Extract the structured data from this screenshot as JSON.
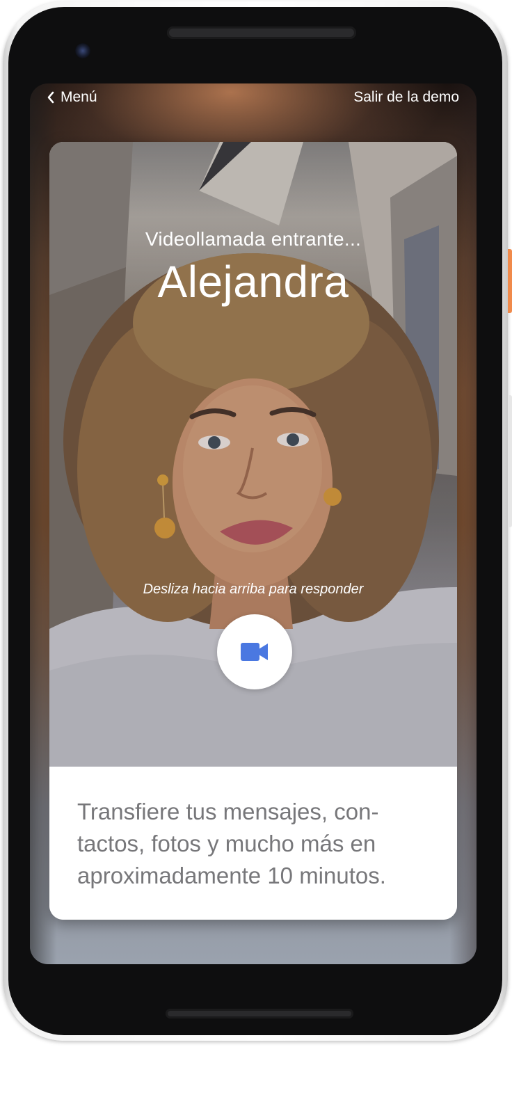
{
  "topbar": {
    "back_label": "Menú",
    "exit_label": "Salir de la demo"
  },
  "call": {
    "incoming_label": "Videollamada entrante...",
    "caller_name": "Alejandra",
    "swipe_hint": "Desliza hacia arriba para responder"
  },
  "caption": {
    "line1": "Transfiere tus mensajes, con-",
    "line2": "tactos, fotos y mucho más en",
    "line3": "aproximadamente 10 minutos."
  },
  "icons": {
    "back": "chevron-left-icon",
    "answer": "video-camera-icon"
  },
  "colors": {
    "accent_blue": "#4a78e1",
    "caption_text": "#77777a",
    "side_button": "#f08a4b"
  }
}
